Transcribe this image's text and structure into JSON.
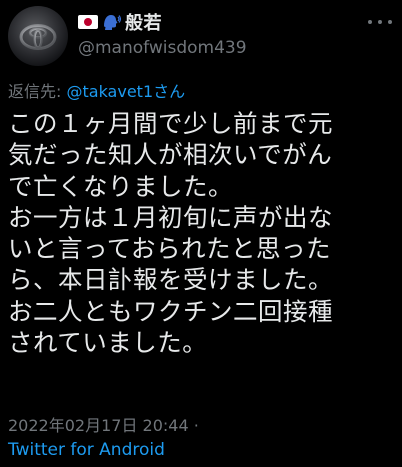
{
  "author": {
    "flag_icon": "japan-flag-icon",
    "speaking_icon": "speaking-head-icon",
    "display_name": "般若",
    "handle": "@manofwisdom439"
  },
  "reply": {
    "prefix": "返信先: ",
    "mention": "@takavet1さん"
  },
  "tweet": {
    "lines": [
      "この１ヶ月間で少し前まで元",
      "気だった知人が相次いでがん",
      "で亡くなりました。",
      "お一方は１月初旬に声が出な",
      "いと言っておられたと思った",
      "ら、本日訃報を受けました。",
      "お二人ともワクチン二回接種",
      "されていました。"
    ]
  },
  "meta": {
    "timestamp": "2022年02月17日 20:44 ·",
    "client": "Twitter for Android"
  },
  "colors": {
    "background": "#000000",
    "text": "#e7e9ea",
    "secondary": "#71767b",
    "link": "#1d9bf0"
  }
}
